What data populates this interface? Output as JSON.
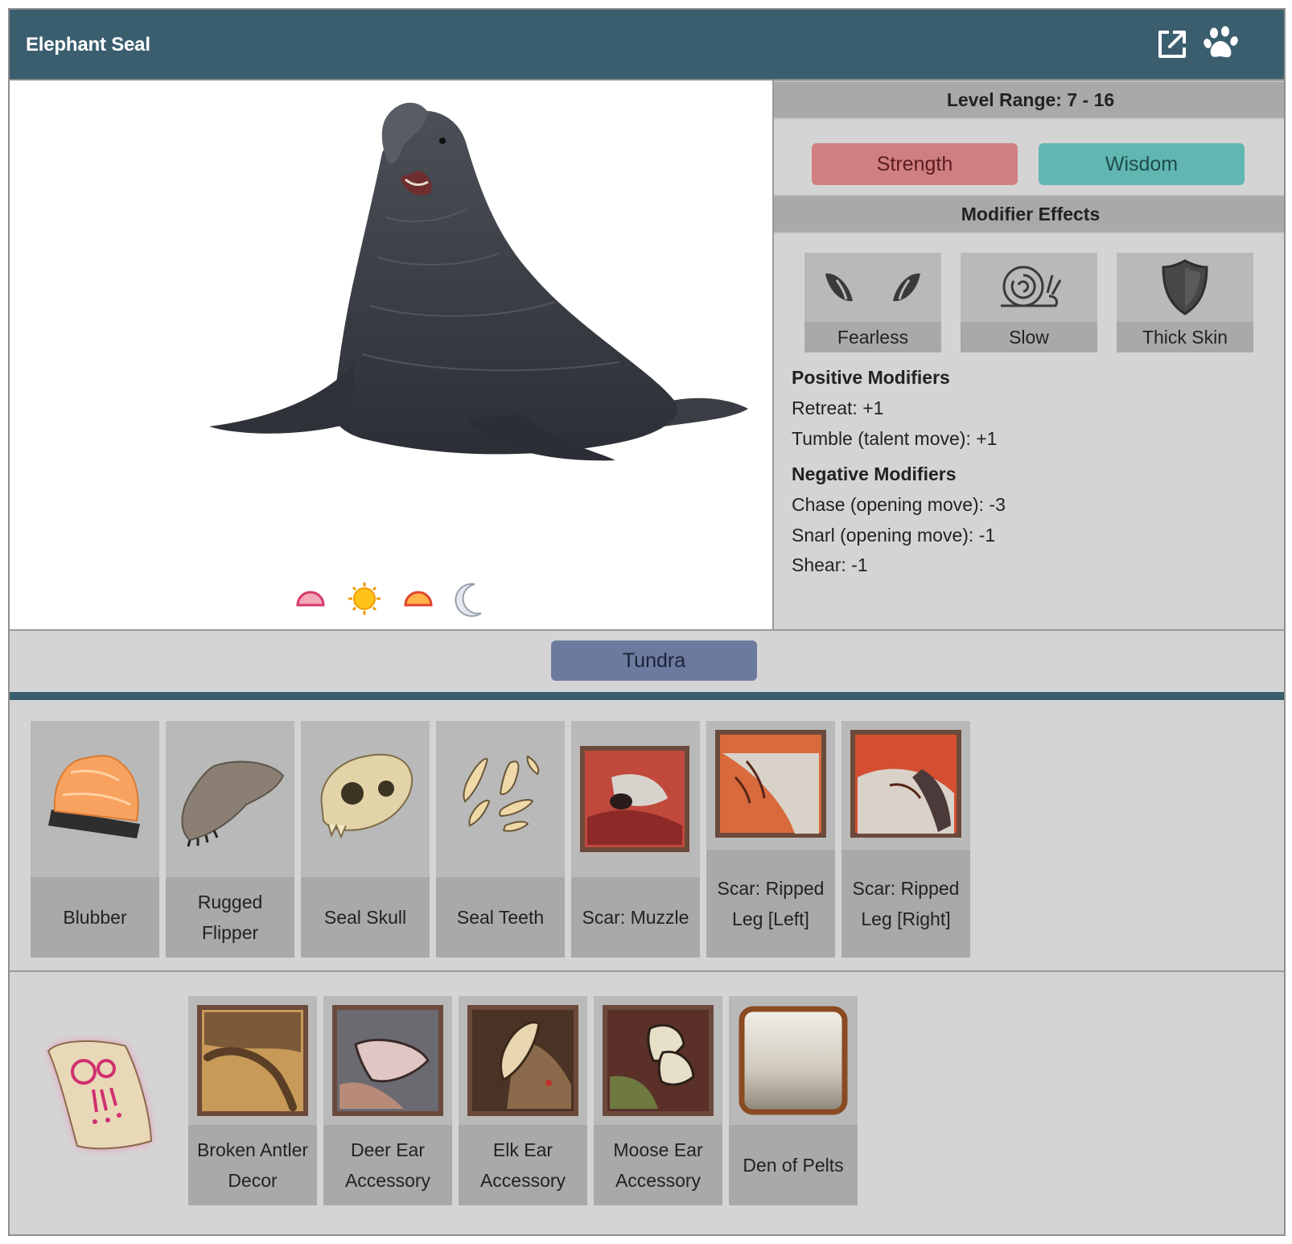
{
  "header": {
    "title": "Elephant Seal"
  },
  "info": {
    "level_range": "Level Range: 7 - 16",
    "stats": [
      "Strength",
      "Wisdom"
    ],
    "modifier_effects_title": "Modifier Effects",
    "effects": [
      {
        "label": "Fearless",
        "icon": "cat-eyes-icon"
      },
      {
        "label": "Slow",
        "icon": "snail-icon"
      },
      {
        "label": "Thick Skin",
        "icon": "shield-icon"
      }
    ],
    "positive_title": "Positive Modifiers",
    "positive": [
      "Retreat: +1",
      "Tumble (talent move): +1"
    ],
    "negative_title": "Negative Modifiers",
    "negative": [
      "Chase (opening move): -3",
      "Snarl (opening move): -1",
      "Shear: -1"
    ]
  },
  "time_icons": [
    "dawn-icon",
    "sun-icon",
    "dusk-icon",
    "moon-icon"
  ],
  "habitat": {
    "label": "Tundra"
  },
  "drops": [
    {
      "label": "Blubber",
      "icon": "blubber-icon"
    },
    {
      "label": "Rugged Flipper",
      "icon": "flipper-icon"
    },
    {
      "label": "Seal Skull",
      "icon": "skull-icon"
    },
    {
      "label": "Seal Teeth",
      "icon": "teeth-icon"
    },
    {
      "label": "Scar: Muzzle",
      "icon": "scar-muzzle-icon"
    },
    {
      "label": "Scar: Ripped Leg [Left]",
      "icon": "scar-leg-left-icon"
    },
    {
      "label": "Scar: Ripped Leg [Right]",
      "icon": "scar-leg-right-icon"
    }
  ],
  "quest_items": [
    {
      "label": "Broken Antler Decor",
      "icon": "antler-decor-icon"
    },
    {
      "label": "Deer Ear Accessory",
      "icon": "deer-ear-icon"
    },
    {
      "label": "Elk Ear Accessory",
      "icon": "elk-ear-icon"
    },
    {
      "label": "Moose Ear Accessory",
      "icon": "moose-ear-icon"
    },
    {
      "label": "Den of Pelts",
      "icon": "pelts-icon"
    }
  ],
  "colors": {
    "header": "#3b5e6f",
    "strength": "#d07f80",
    "wisdom": "#62b6b1",
    "tundra": "#6c7a9e",
    "panel": "#d4d4d4",
    "tile": "#b9b9b9"
  }
}
